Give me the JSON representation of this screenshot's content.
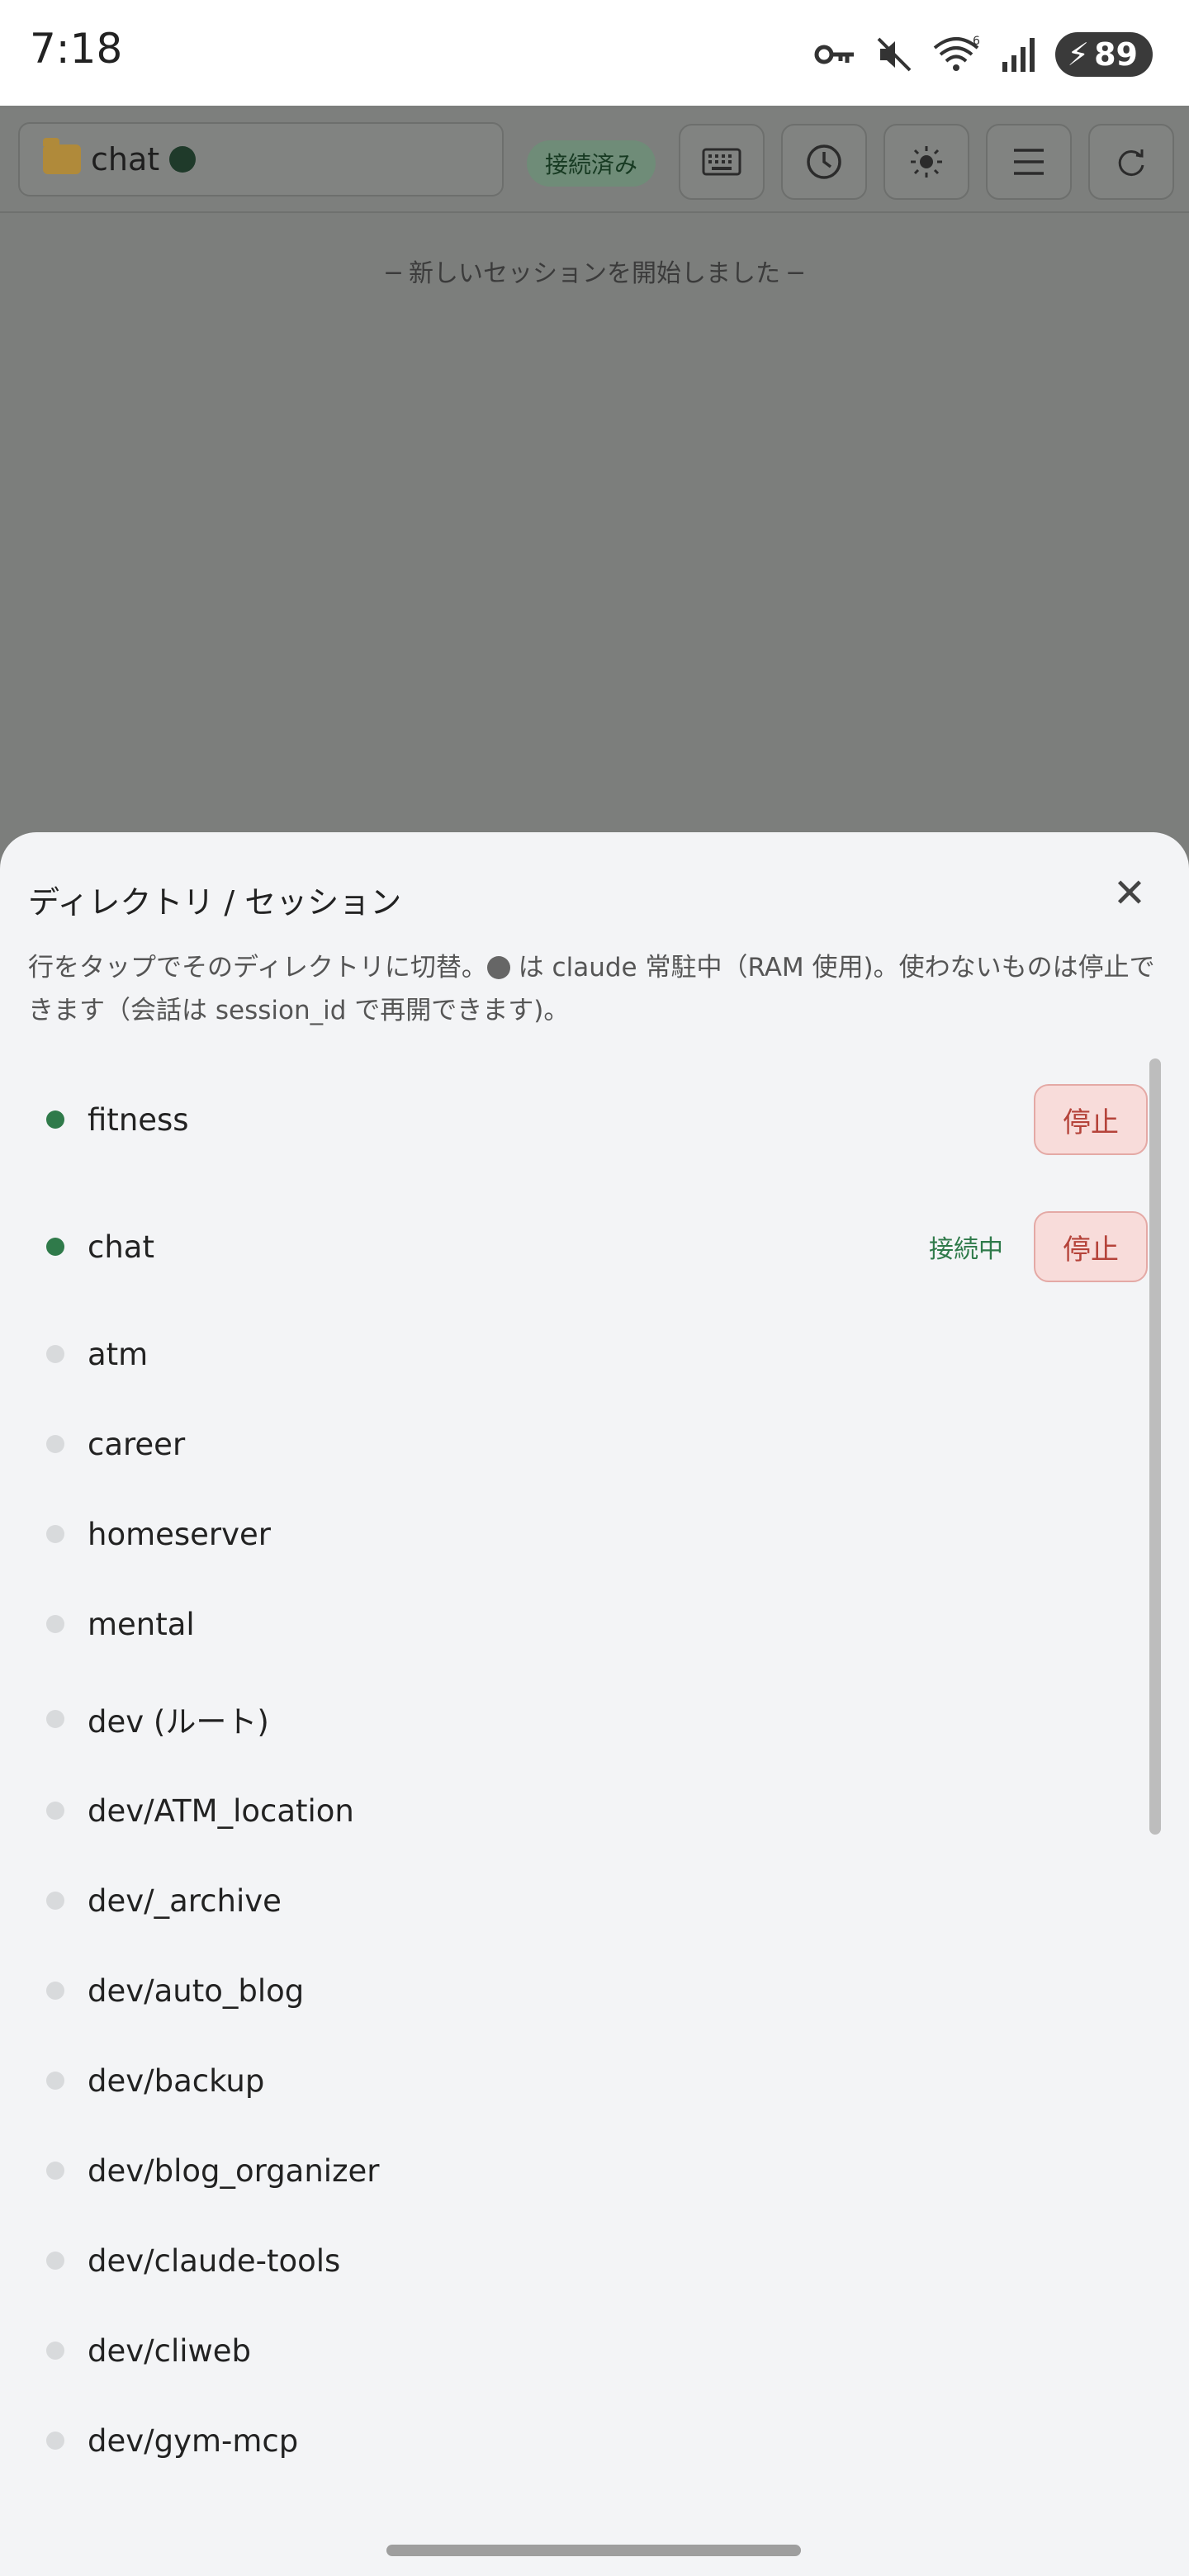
{
  "status_bar": {
    "time": "7:18",
    "battery": "89",
    "icons": [
      "vpn-key-icon",
      "mute-icon",
      "wifi-icon",
      "signal-icon",
      "battery-charging-icon"
    ],
    "wifi_badge": "6"
  },
  "toolbar": {
    "dir_name": "chat",
    "connection_status": "接続済み",
    "buttons": [
      "keyboard-icon",
      "history-icon",
      "theme-icon",
      "menu-icon",
      "refresh-icon"
    ]
  },
  "main": {
    "session_message": "─ 新しいセッションを開始しました ─"
  },
  "sheet": {
    "title": "ディレクトリ / セッション",
    "close": "✕",
    "desc_part1": "行をタップでそのディレクトリに切替。",
    "desc_part2": " は claude 常駐中（RAM 使用)。使わないものは停止できます（会話は session_id で再開できます)。",
    "items": [
      {
        "name": "fitness",
        "active": true,
        "status": "",
        "stop_label": "停止"
      },
      {
        "name": "chat",
        "active": true,
        "status": "接続中",
        "stop_label": "停止"
      },
      {
        "name": "atm",
        "active": false
      },
      {
        "name": "career",
        "active": false
      },
      {
        "name": "homeserver",
        "active": false
      },
      {
        "name": "mental",
        "active": false
      },
      {
        "name": "dev (ルート)",
        "active": false
      },
      {
        "name": "dev/ATM_location",
        "active": false
      },
      {
        "name": "dev/_archive",
        "active": false
      },
      {
        "name": "dev/auto_blog",
        "active": false
      },
      {
        "name": "dev/backup",
        "active": false
      },
      {
        "name": "dev/blog_organizer",
        "active": false
      },
      {
        "name": "dev/claude-tools",
        "active": false
      },
      {
        "name": "dev/cliweb",
        "active": false
      },
      {
        "name": "dev/gym-mcp",
        "active": false
      }
    ]
  },
  "colors": {
    "active_dot": "#2f7a4a",
    "inactive_dot": "#d8dadc",
    "stop_bg": "#f8dcda",
    "stop_text": "#b5433a",
    "overlay": "#7c7e7c"
  }
}
